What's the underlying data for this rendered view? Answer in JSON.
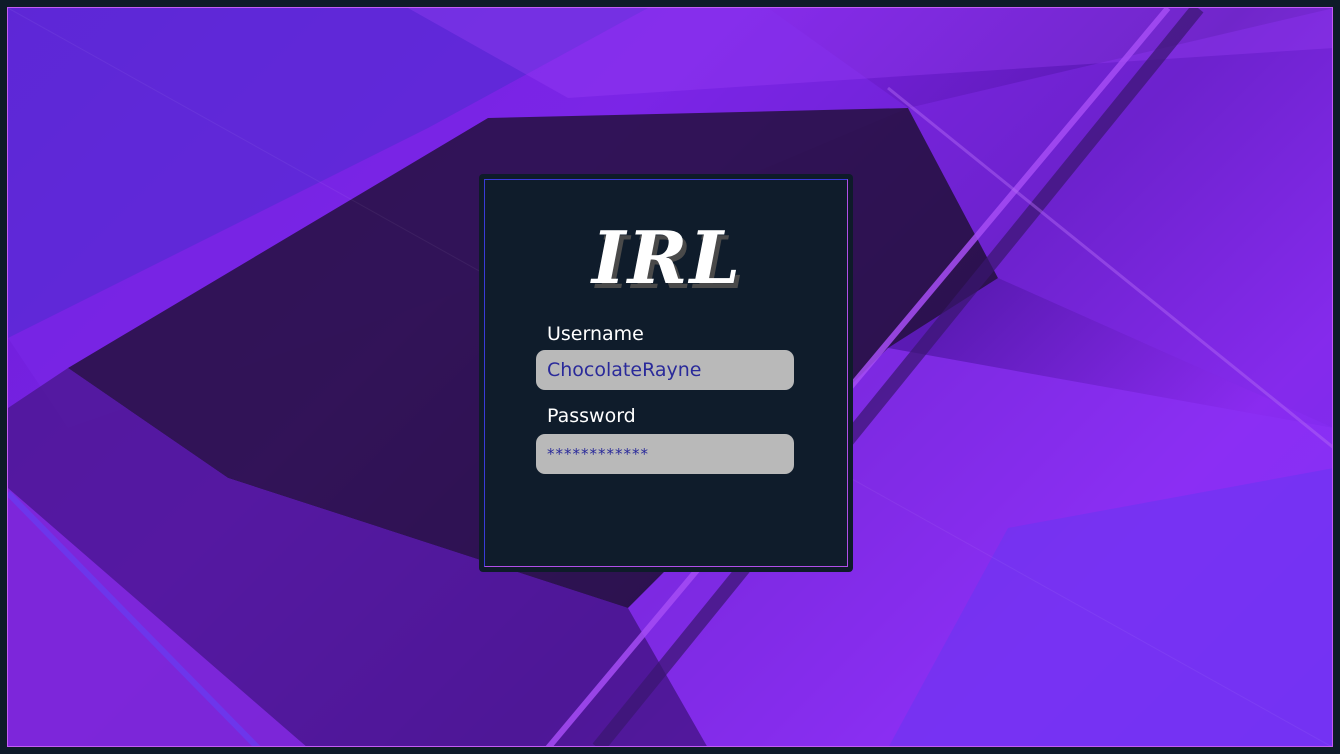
{
  "app": {
    "logo_text": "IRL"
  },
  "login": {
    "username_label": "Username",
    "username_value": "ChocolateRayne",
    "password_label": "Password",
    "password_value": "************"
  },
  "colors": {
    "background_frame": "#0e1b29",
    "card_background": "#0f1c2b",
    "field_background": "#b9b9b9",
    "field_text": "#2a2a9a",
    "accent_purple": "#8a2bf0"
  }
}
